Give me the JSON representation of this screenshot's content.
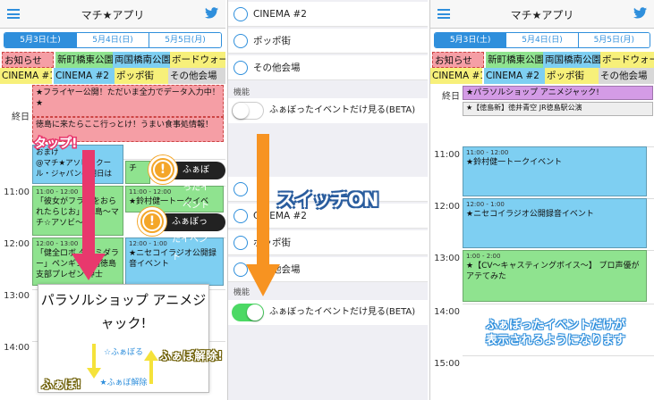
{
  "app": {
    "title": "マチ★アプリ"
  },
  "tabs": [
    "5月3日(土)",
    "5月4日(日)",
    "5月5日(月)"
  ],
  "venues": {
    "row1": [
      "お知らせ",
      "新町橋東公園",
      "両国橋南公園",
      "ボードウォーク"
    ],
    "row2": [
      "CINEMA #1",
      "CINEMA #2",
      "ポッポ街",
      "その他会場"
    ]
  },
  "times": [
    "終日",
    "11:00",
    "12:00",
    "13:00",
    "14:00",
    "15:00"
  ],
  "panel1": {
    "allday": [
      "★フライヤー公開！ただいま全力でデータ入力中！★",
      "徳島に来たらここ行っとけ！うまい食事処情報！"
    ],
    "events": {
      "e1": "おまけ",
      "e1b": "@マチ★アソビ！クール・ジャパンの明日は",
      "e2_time": "11:00 - 12:00",
      "e2": "「彼女がフラグをおられたらじお」 徳島〜マチ☆アソビ〜",
      "e3_time": "12:00 - 13:00",
      "e3": "「健全ロボ ダイミダラー」ペンギン帝国徳島支部プレゼン 紳士",
      "e4": "★鈴村健一トークイベ",
      "e5_time": "12:00 - 1:00",
      "e5": "★ニセコイラジオ公開録音イベント",
      "e6": "の稲場",
      "side1": "チ",
      "side2": "ント"
    },
    "tap_label": "タップ!",
    "fubo_label": "ふぁぼ!",
    "unfubo_label": "ふぁぼ解除!",
    "popup": {
      "title": "パラソルショップ アニメジャック!",
      "fav": "☆ふぁぼる",
      "unfav": "★ふぁぼ解除"
    },
    "callouts": [
      "ふぁぼったイベント",
      "ふぁぼったイベント"
    ]
  },
  "panel2": {
    "rows_top": [
      "CINEMA #2",
      "ポッポ街",
      "その他会場"
    ],
    "section": "機能",
    "switch_label": "ふぁぼったイベントだけ見る(BETA)",
    "rows_bottom": [
      "CINEMA #2",
      "ポッポ街",
      "その他会場"
    ],
    "big_label": "スイッチON"
  },
  "panel3": {
    "allday": "★パラソルショップ アニメジャック!",
    "partial": "★【徳島新】徳井青空 JR徳島駅公演",
    "ev1_time": "11:00 - 12:00",
    "ev1": "★鈴村健一トークイベント",
    "ev2_time": "12:00 - 1:00",
    "ev2": "★ニセコイラジオ公開録音イベント",
    "ev3_time": "1:00 - 2:00",
    "ev3": "★【CV〜キャスティングボイス〜】 プロ声優がアテてみた",
    "caption": [
      "ふぁぼったイベントだけが",
      "表示されるようになります"
    ]
  }
}
